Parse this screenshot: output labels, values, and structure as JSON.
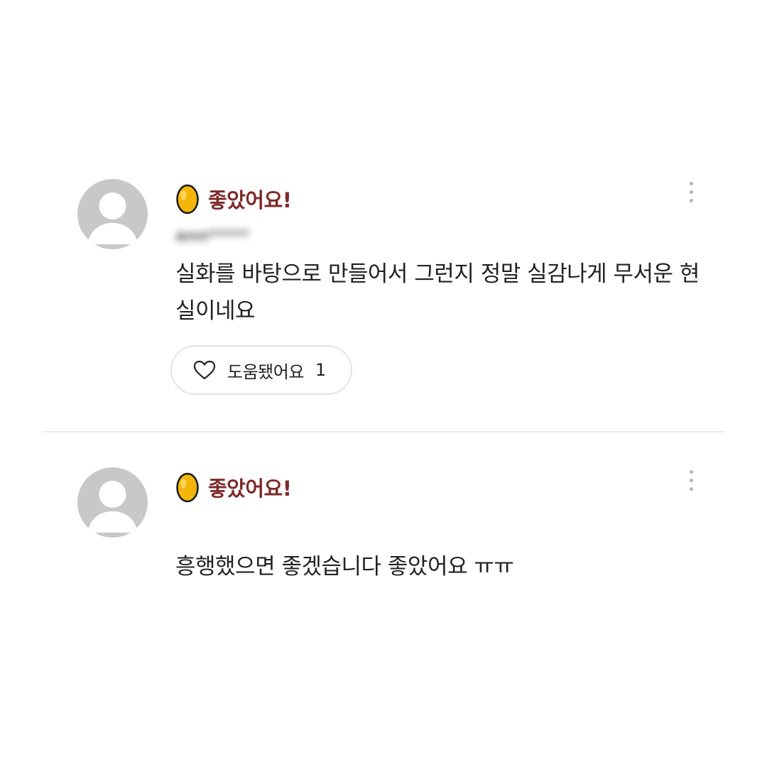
{
  "colors": {
    "rating_label": "#7d2a2a",
    "avatar_bg": "#c8c8c8",
    "egg_fill": "#f5b50a",
    "divider": "#ececec"
  },
  "reviews": [
    {
      "rating_icon": "golden-egg-icon",
      "rating_label": "좋았어요!",
      "reviewer": "ann*****",
      "date": "",
      "text": "실화를 바탕으로 만들어서 그런지 정말 실감나게 무서운 현실이네요",
      "helpful": {
        "icon": "heart-outline-icon",
        "label": "도움됐어요",
        "count": "1"
      }
    },
    {
      "rating_icon": "golden-egg-icon",
      "rating_label": "좋았어요!",
      "reviewer": "",
      "date": "",
      "text": "흥행했으면 좋겠습니다 좋았어요 ㅠㅠ"
    }
  ]
}
